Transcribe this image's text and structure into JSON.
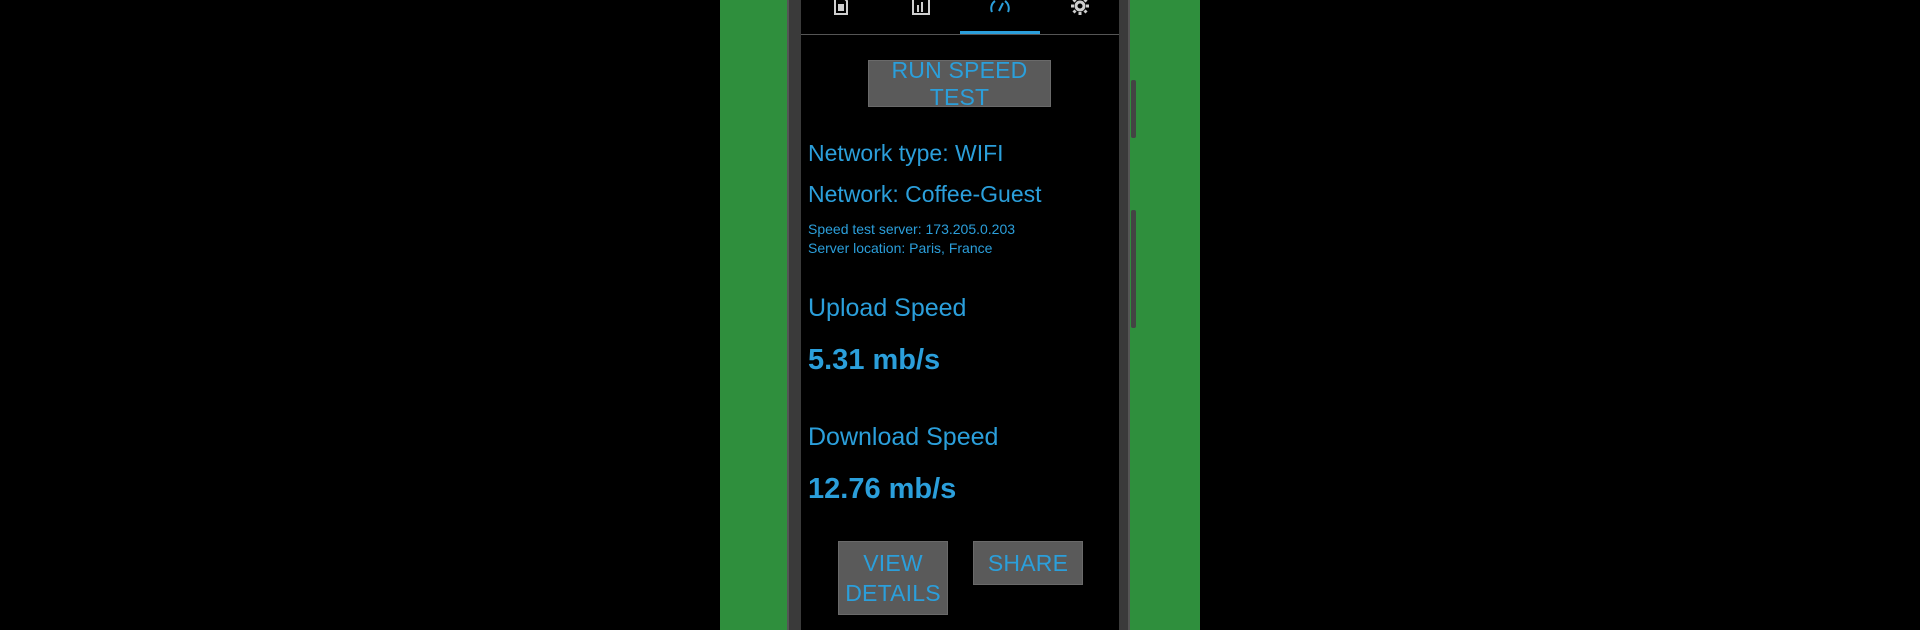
{
  "colors": {
    "accent": "#2b9fdb",
    "background": "#000000",
    "button_bg": "#5a5a5a",
    "outer_panel": "#2f8f3d"
  },
  "tabs": [
    {
      "icon": "sim-card-icon",
      "active": false
    },
    {
      "icon": "cell-tower-icon",
      "active": false
    },
    {
      "icon": "speedometer-icon",
      "active": true
    },
    {
      "icon": "gear-icon",
      "active": false
    }
  ],
  "run_button": "RUN SPEED TEST",
  "network": {
    "type_line": "Network type: WIFI",
    "name_line": "Network: Coffee-Guest",
    "server_line": "Speed test server: 173.205.0.203",
    "location_line": "Server location: Paris, France"
  },
  "upload": {
    "label": "Upload Speed",
    "value": "5.31 mb/s"
  },
  "download": {
    "label": "Download Speed",
    "value": "12.76 mb/s"
  },
  "actions": {
    "view_details_line1": "VIEW",
    "view_details_line2": "DETAILS",
    "share": "SHARE"
  }
}
